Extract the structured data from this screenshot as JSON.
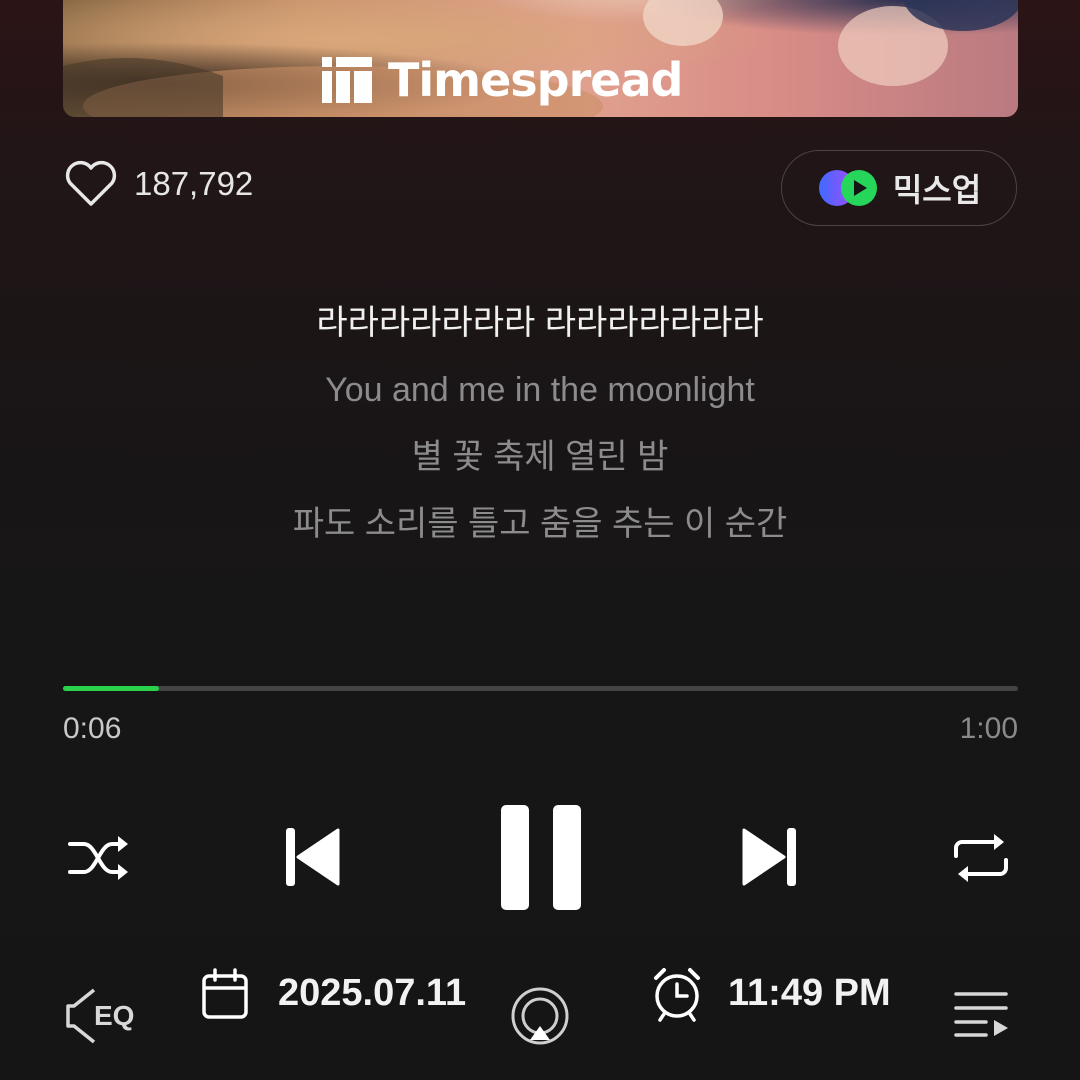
{
  "banner": {
    "brand": "Timespread"
  },
  "like": {
    "count": "187,792"
  },
  "mixup": {
    "label": "믹스업"
  },
  "lyrics": [
    {
      "text": "라라라라라라라 라라라라라라라",
      "current": true
    },
    {
      "text": "You and me in the moonlight",
      "current": false
    },
    {
      "text": "별 꽃 축제 열린 밤",
      "current": false
    },
    {
      "text": "파도 소리를 틀고 춤을 추는 이 순간",
      "current": false
    }
  ],
  "playback": {
    "elapsed": "0:06",
    "total": "1:00",
    "progress": 0.1
  },
  "controls": {
    "state": "playing"
  },
  "footer": {
    "eq_label": "EQ",
    "date": "2025.07.11",
    "alarm_time": "11:49 PM"
  },
  "colors": {
    "accent": "#2ad14a",
    "background": "#161616"
  }
}
